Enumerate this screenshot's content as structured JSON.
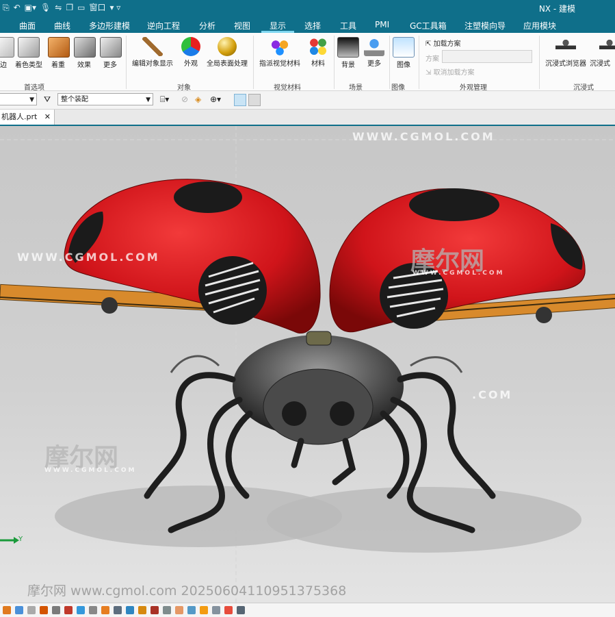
{
  "app": {
    "title": "NX - 建模"
  },
  "quick_access": {
    "window_label": "窗口"
  },
  "menu": {
    "items": [
      "曲面",
      "曲线",
      "多边形建模",
      "逆向工程",
      "分析",
      "视图",
      "显示",
      "选择",
      "工具",
      "PMI",
      "GC工具箱",
      "注塑模向导",
      "应用模块"
    ],
    "active": "显示"
  },
  "ribbon": {
    "groups": {
      "prefs": "首选项",
      "object": "对象",
      "visual_material": "视觉材料",
      "scene": "场景",
      "image": "图像",
      "appearance_mgmt": "外观管理",
      "immersive": "沉浸式"
    },
    "buttons": {
      "edge": "边",
      "shading_type": "着色类型",
      "shade": "着重",
      "effects": "效果",
      "more": "更多",
      "edit_display": "编辑对象显示",
      "appearance": "外观",
      "global_surface": "全局表面处理",
      "assign_material": "指派视觉材料",
      "material": "材料",
      "background": "背景",
      "more2": "更多",
      "image": "图像",
      "immersive_browser": "沉浸式浏览器",
      "immersive2": "沉浸式"
    },
    "appearance_panel": {
      "load_scheme": "加载方案",
      "scheme_label": "方案",
      "unload_scheme": "取消加载方案"
    }
  },
  "toolbar": {
    "filter_value": "",
    "assembly_scope": "整个装配"
  },
  "tab": {
    "name": "机器人.prt"
  },
  "viewport": {
    "axis_label": "Y",
    "watermarks": [
      "WWW.CGMOL.COM",
      "WWW.CGMOL.COM",
      ".COM",
      "摩尔网",
      "摩尔网",
      "WWW.CGMOL.COM",
      "WWW.CGMOL.COM"
    ],
    "footer_watermark": "摩尔网 www.cgmol.com 20250604110951375368"
  },
  "colors": {
    "header": "#0f6f8a",
    "accent": "#7fd7f0",
    "shell_red": "#d0141a"
  }
}
